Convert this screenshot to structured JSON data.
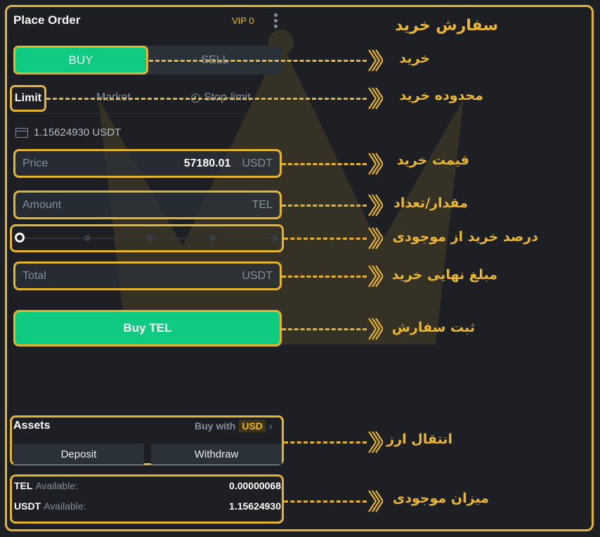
{
  "panel": {
    "title": "Place Order",
    "vip_label": "VIP 0",
    "more_icon": "vertical-dots-icon"
  },
  "side_tabs": {
    "buy": "BUY",
    "sell": "SELL",
    "active": "buy"
  },
  "order_types": {
    "limit": "Limit",
    "market": "Market",
    "stop_limit": "Stop-limit",
    "active": "limit"
  },
  "balance": {
    "icon": "wallet-icon",
    "text": "1.15624930 USDT"
  },
  "price_field": {
    "label": "Price",
    "value": "57180.01",
    "unit": "USDT"
  },
  "amount_field": {
    "label": "Amount",
    "value": "",
    "unit": "TEL"
  },
  "slider": {
    "percent": 0,
    "stops": [
      0,
      25,
      50,
      75,
      100
    ]
  },
  "total_field": {
    "label": "Total",
    "value": "",
    "unit": "USDT"
  },
  "submit_button": {
    "label": "Buy TEL"
  },
  "assets": {
    "title": "Assets",
    "buy_with_label": "Buy with",
    "buy_with_currency": "USD",
    "deposit": "Deposit",
    "withdraw": "Withdraw"
  },
  "available": [
    {
      "coin": "TEL",
      "label": "Available:",
      "amount": "0.00000068"
    },
    {
      "coin": "USDT",
      "label": "Available:",
      "amount": "1.15624930"
    }
  ],
  "annotations": {
    "heading": "سفارش خرید",
    "buy": "خرید",
    "order_type": "محدوده خرید",
    "price": "قیمت خرید",
    "amount": "مقدار/تعداد",
    "percent": "درصد خرید از موجودی",
    "total": "مبلغ نهایی خرید",
    "submit": "ثبت سفارش",
    "transfer": "انتقال ارز",
    "balance": "میزان موجودی"
  },
  "colors": {
    "accent": "#e3b430",
    "buy_green": "#0ecb81",
    "background": "#1e1f24",
    "vip": "#f0b90b"
  }
}
